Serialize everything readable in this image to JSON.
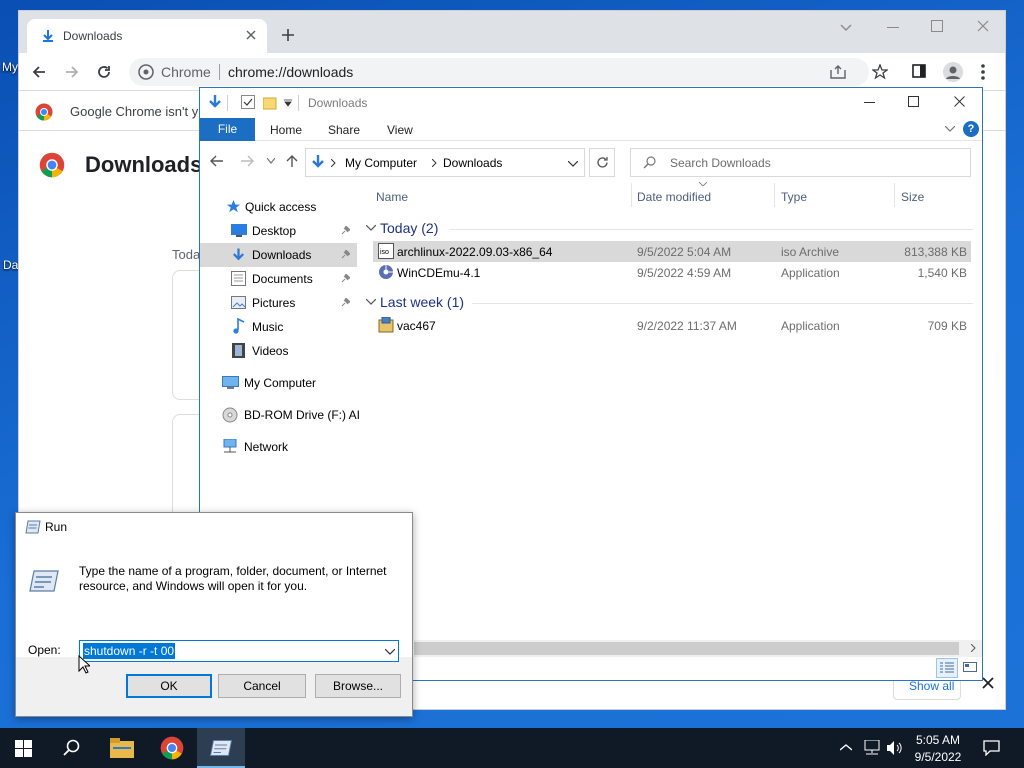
{
  "desktop": {
    "icon_labels": [
      "My",
      "Da"
    ]
  },
  "chrome": {
    "tab_title": "Downloads",
    "omnibox_site": "Chrome",
    "omnibox_url": "chrome://downloads",
    "infobar_text": "Google Chrome isn't y",
    "page_heading": "Downloads",
    "today_label": "Toda",
    "show_all_label": "Show all"
  },
  "explorer": {
    "title": "Downloads",
    "ribbon_tabs": [
      "File",
      "Home",
      "Share",
      "View"
    ],
    "breadcrumb": [
      "My Computer",
      "Downloads"
    ],
    "search_placeholder": "Search Downloads",
    "nav_items": [
      {
        "label": "Quick access",
        "icon": "star-icon",
        "pinned": false
      },
      {
        "label": "Desktop",
        "icon": "desktop-icon",
        "pinned": true
      },
      {
        "label": "Downloads",
        "icon": "download-icon",
        "pinned": true,
        "selected": true
      },
      {
        "label": "Documents",
        "icon": "documents-icon",
        "pinned": true
      },
      {
        "label": "Pictures",
        "icon": "pictures-icon",
        "pinned": true
      },
      {
        "label": "Music",
        "icon": "music-icon",
        "pinned": false
      },
      {
        "label": "Videos",
        "icon": "videos-icon",
        "pinned": false
      },
      {
        "label": "My Computer",
        "icon": "computer-icon",
        "pinned": false
      },
      {
        "label": "BD-ROM Drive (F:) AI",
        "icon": "disc-icon",
        "pinned": false
      },
      {
        "label": "Network",
        "icon": "network-icon",
        "pinned": false
      }
    ],
    "columns": [
      "Name",
      "Date modified",
      "Type",
      "Size"
    ],
    "groups": [
      {
        "label": "Today (2)",
        "files": [
          {
            "name": "archlinux-2022.09.03-x86_64",
            "date": "9/5/2022 5:04 AM",
            "type": "iso Archive",
            "size": "813,388 KB",
            "icon": "iso-icon",
            "selected": true
          },
          {
            "name": "WinCDEmu-4.1",
            "date": "9/5/2022 4:59 AM",
            "type": "Application",
            "size": "1,540 KB",
            "icon": "app-icon",
            "selected": false
          }
        ]
      },
      {
        "label": "Last week (1)",
        "files": [
          {
            "name": "vac467",
            "date": "9/2/2022 11:37 AM",
            "type": "Application",
            "size": "709 KB",
            "icon": "installer-icon",
            "selected": false
          }
        ]
      }
    ]
  },
  "run": {
    "title": "Run",
    "description": "Type the name of a program, folder, document, or Internet resource, and Windows will open it for you.",
    "open_label": "Open:",
    "command_value": "shutdown -r -t 00",
    "ok_label": "OK",
    "cancel_label": "Cancel",
    "browse_label": "Browse..."
  },
  "taskbar": {
    "time": "5:05 AM",
    "date": "9/5/2022"
  },
  "colors": {
    "accent": "#0078d7",
    "ribbon_file": "#1b6ec2",
    "group_header": "#1e3287",
    "taskbar": "#101a26"
  }
}
